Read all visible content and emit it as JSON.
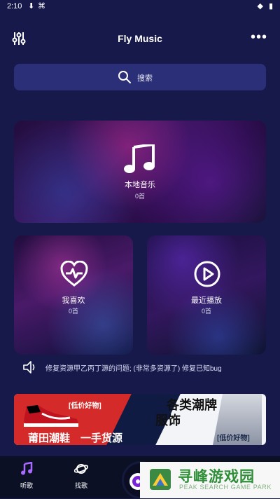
{
  "status_bar": {
    "time": "2:10"
  },
  "header": {
    "title": "Fly Music"
  },
  "search": {
    "placeholder": "搜索"
  },
  "cards": {
    "local": {
      "label": "本地音乐",
      "count": "0首"
    },
    "favorites": {
      "label": "我喜欢",
      "count": "0首"
    },
    "recent": {
      "label": "最近播放",
      "count": "0首"
    }
  },
  "notice": {
    "text": "修复资源甲乙丙丁源的问题; (非常多资源了) 修复已知bug"
  },
  "banner": {
    "tag_left": "[低价好物]",
    "headline_left": "莆田潮鞋　一手货源",
    "headline_right_1": "各类潮牌",
    "headline_right_2": "服饰",
    "tag_right": "[低价好物]"
  },
  "bottom_nav": {
    "items": [
      {
        "label": "听歌"
      },
      {
        "label": "找歌"
      }
    ]
  },
  "watermark": {
    "cn": "寻峰游戏园",
    "en": "PEAK SEARCH GAME PARK"
  },
  "colors": {
    "background": "#16194a",
    "search_bg": "#2b2f77",
    "bottom_bar": "#0b1025"
  }
}
